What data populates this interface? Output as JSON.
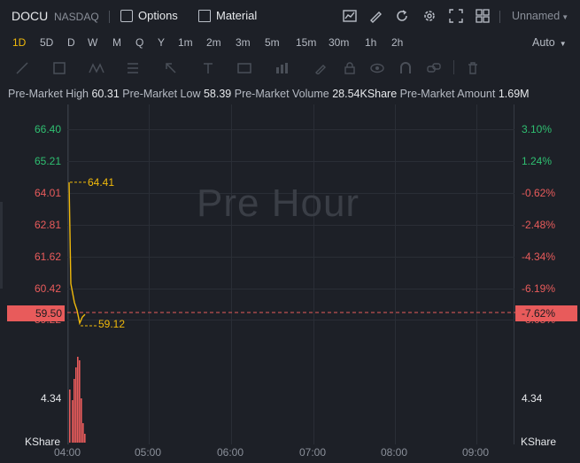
{
  "header": {
    "symbol": "DOCU",
    "exchange": "NASDAQ",
    "options_label": "Options",
    "material_label": "Material",
    "layout_label": "Unnamed"
  },
  "periods": [
    "1D",
    "5D",
    "D",
    "W",
    "M",
    "Q",
    "Y",
    "1m",
    "2m",
    "3m",
    "5m",
    "15m",
    "30m",
    "1h",
    "2h"
  ],
  "active_period": "1D",
  "auto_label": "Auto",
  "stats": {
    "high_label": "Pre-Market High",
    "high_value": "60.31",
    "low_label": "Pre-Market Low",
    "low_value": "58.39",
    "volume_label": "Pre-Market Volume",
    "volume_value": "28.54KShare",
    "amount_label": "Pre-Market Amount",
    "amount_value": "1.69M"
  },
  "watermark": "Pre Hour",
  "chart_data": {
    "type": "line",
    "x_ticks": [
      "04:00",
      "05:00",
      "06:00",
      "07:00",
      "08:00",
      "09:00"
    ],
    "y_left_ticks": [
      "66.40",
      "65.21",
      "64.01",
      "62.81",
      "61.62",
      "60.42",
      "59.22"
    ],
    "y_right_ticks": [
      "3.10%",
      "1.24%",
      "-0.62%",
      "-2.48%",
      "-4.34%",
      "-6.19%",
      "-8.05%"
    ],
    "y_left_colors": [
      "#2fbf71",
      "#2fbf71",
      "#e85b5b",
      "#e85b5b",
      "#e85b5b",
      "#e85b5b",
      "#e85b5b"
    ],
    "y_right_colors": [
      "#2fbf71",
      "#2fbf71",
      "#e85b5b",
      "#e85b5b",
      "#e85b5b",
      "#e85b5b",
      "#e85b5b"
    ],
    "ylim": [
      59.22,
      66.4
    ],
    "high_annotation": "64.41",
    "low_annotation": "59.12",
    "current_price": "59.50",
    "current_change": "-7.62%",
    "volume_axis_tick": "4.34",
    "volume_unit": "KShare",
    "line_color": "#f0b90b",
    "volume_color": "#e85b5b"
  }
}
